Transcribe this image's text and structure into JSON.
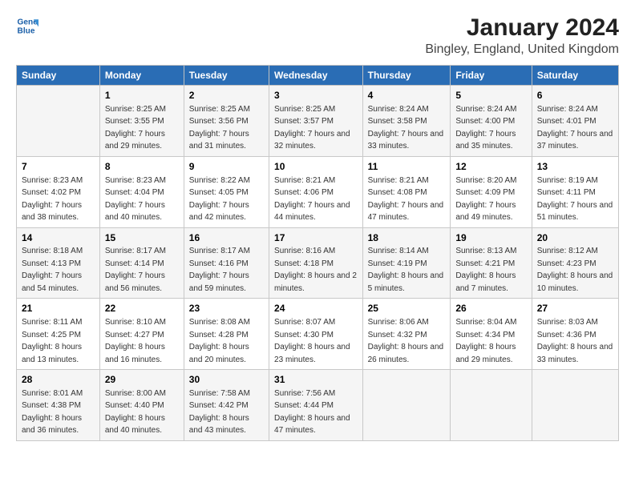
{
  "header": {
    "logo_line1": "General",
    "logo_line2": "Blue",
    "title": "January 2024",
    "subtitle": "Bingley, England, United Kingdom"
  },
  "days": [
    "Sunday",
    "Monday",
    "Tuesday",
    "Wednesday",
    "Thursday",
    "Friday",
    "Saturday"
  ],
  "weeks": [
    [
      {
        "date": "",
        "sunrise": "",
        "sunset": "",
        "daylight": ""
      },
      {
        "date": "1",
        "sunrise": "8:25 AM",
        "sunset": "3:55 PM",
        "daylight": "7 hours and 29 minutes."
      },
      {
        "date": "2",
        "sunrise": "8:25 AM",
        "sunset": "3:56 PM",
        "daylight": "7 hours and 31 minutes."
      },
      {
        "date": "3",
        "sunrise": "8:25 AM",
        "sunset": "3:57 PM",
        "daylight": "7 hours and 32 minutes."
      },
      {
        "date": "4",
        "sunrise": "8:24 AM",
        "sunset": "3:58 PM",
        "daylight": "7 hours and 33 minutes."
      },
      {
        "date": "5",
        "sunrise": "8:24 AM",
        "sunset": "4:00 PM",
        "daylight": "7 hours and 35 minutes."
      },
      {
        "date": "6",
        "sunrise": "8:24 AM",
        "sunset": "4:01 PM",
        "daylight": "7 hours and 37 minutes."
      }
    ],
    [
      {
        "date": "7",
        "sunrise": "8:23 AM",
        "sunset": "4:02 PM",
        "daylight": "7 hours and 38 minutes."
      },
      {
        "date": "8",
        "sunrise": "8:23 AM",
        "sunset": "4:04 PM",
        "daylight": "7 hours and 40 minutes."
      },
      {
        "date": "9",
        "sunrise": "8:22 AM",
        "sunset": "4:05 PM",
        "daylight": "7 hours and 42 minutes."
      },
      {
        "date": "10",
        "sunrise": "8:21 AM",
        "sunset": "4:06 PM",
        "daylight": "7 hours and 44 minutes."
      },
      {
        "date": "11",
        "sunrise": "8:21 AM",
        "sunset": "4:08 PM",
        "daylight": "7 hours and 47 minutes."
      },
      {
        "date": "12",
        "sunrise": "8:20 AM",
        "sunset": "4:09 PM",
        "daylight": "7 hours and 49 minutes."
      },
      {
        "date": "13",
        "sunrise": "8:19 AM",
        "sunset": "4:11 PM",
        "daylight": "7 hours and 51 minutes."
      }
    ],
    [
      {
        "date": "14",
        "sunrise": "8:18 AM",
        "sunset": "4:13 PM",
        "daylight": "7 hours and 54 minutes."
      },
      {
        "date": "15",
        "sunrise": "8:17 AM",
        "sunset": "4:14 PM",
        "daylight": "7 hours and 56 minutes."
      },
      {
        "date": "16",
        "sunrise": "8:17 AM",
        "sunset": "4:16 PM",
        "daylight": "7 hours and 59 minutes."
      },
      {
        "date": "17",
        "sunrise": "8:16 AM",
        "sunset": "4:18 PM",
        "daylight": "8 hours and 2 minutes."
      },
      {
        "date": "18",
        "sunrise": "8:14 AM",
        "sunset": "4:19 PM",
        "daylight": "8 hours and 5 minutes."
      },
      {
        "date": "19",
        "sunrise": "8:13 AM",
        "sunset": "4:21 PM",
        "daylight": "8 hours and 7 minutes."
      },
      {
        "date": "20",
        "sunrise": "8:12 AM",
        "sunset": "4:23 PM",
        "daylight": "8 hours and 10 minutes."
      }
    ],
    [
      {
        "date": "21",
        "sunrise": "8:11 AM",
        "sunset": "4:25 PM",
        "daylight": "8 hours and 13 minutes."
      },
      {
        "date": "22",
        "sunrise": "8:10 AM",
        "sunset": "4:27 PM",
        "daylight": "8 hours and 16 minutes."
      },
      {
        "date": "23",
        "sunrise": "8:08 AM",
        "sunset": "4:28 PM",
        "daylight": "8 hours and 20 minutes."
      },
      {
        "date": "24",
        "sunrise": "8:07 AM",
        "sunset": "4:30 PM",
        "daylight": "8 hours and 23 minutes."
      },
      {
        "date": "25",
        "sunrise": "8:06 AM",
        "sunset": "4:32 PM",
        "daylight": "8 hours and 26 minutes."
      },
      {
        "date": "26",
        "sunrise": "8:04 AM",
        "sunset": "4:34 PM",
        "daylight": "8 hours and 29 minutes."
      },
      {
        "date": "27",
        "sunrise": "8:03 AM",
        "sunset": "4:36 PM",
        "daylight": "8 hours and 33 minutes."
      }
    ],
    [
      {
        "date": "28",
        "sunrise": "8:01 AM",
        "sunset": "4:38 PM",
        "daylight": "8 hours and 36 minutes."
      },
      {
        "date": "29",
        "sunrise": "8:00 AM",
        "sunset": "4:40 PM",
        "daylight": "8 hours and 40 minutes."
      },
      {
        "date": "30",
        "sunrise": "7:58 AM",
        "sunset": "4:42 PM",
        "daylight": "8 hours and 43 minutes."
      },
      {
        "date": "31",
        "sunrise": "7:56 AM",
        "sunset": "4:44 PM",
        "daylight": "8 hours and 47 minutes."
      },
      {
        "date": "",
        "sunrise": "",
        "sunset": "",
        "daylight": ""
      },
      {
        "date": "",
        "sunrise": "",
        "sunset": "",
        "daylight": ""
      },
      {
        "date": "",
        "sunrise": "",
        "sunset": "",
        "daylight": ""
      }
    ]
  ]
}
